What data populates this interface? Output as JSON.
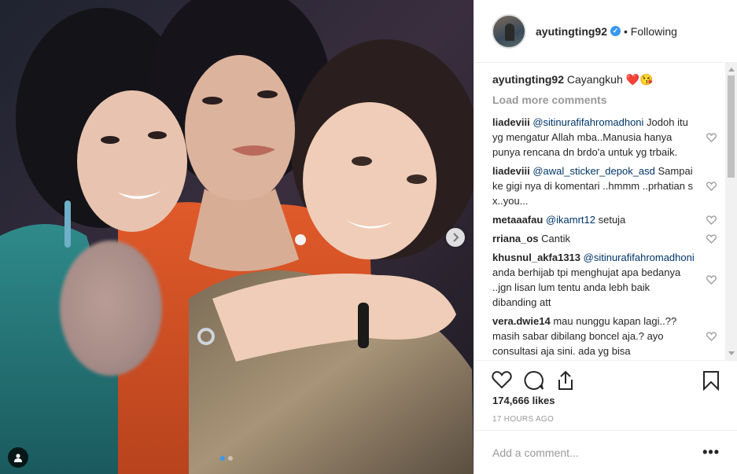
{
  "post": {
    "username": "ayutingting92",
    "follow_status": "• Following",
    "caption_user": "ayutingting92",
    "caption_text": "Cayangkuh ❤️😘",
    "load_more": "Load more comments",
    "likes": "174,666 likes",
    "time": "17 HOURS AGO",
    "add_comment_placeholder": "Add a comment...",
    "more_label": "•••"
  },
  "comments": [
    {
      "user": "liadeviii",
      "mention": "@sitinurafifahromadhoni",
      "text": " Jodoh itu yg mengatur Allah mba..Manusia hanya punya rencana dn brdo'a untuk yg trbaik."
    },
    {
      "user": "liadeviii",
      "mention": "@awal_sticker_depok_asd",
      "text": " Sampai ke gigi nya di komentari ..hmmm ..prhatian s x..you..."
    },
    {
      "user": "metaaafau",
      "mention": "@ikamrt12",
      "text": " setuja"
    },
    {
      "user": "rriana_os",
      "mention": "",
      "text": "Cantik"
    },
    {
      "user": "khusnul_akfa1313",
      "mention": "@sitinurafifahromadhoni",
      "text": " anda berhijab tpi menghujat apa bedanya ..jgn lisan lum tentu anda lebh baik dibanding att"
    },
    {
      "user": "vera.dwie14",
      "mention": "",
      "text": "mau nunggu kapan lagi..?? masih sabar dibilang boncel aja.? ayo consultasi aja sini. ada yg bisa"
    }
  ],
  "icons": {
    "like": "heart-icon",
    "comment": "comment-icon",
    "share": "share-icon",
    "save": "bookmark-icon",
    "next": "chevron-right-icon",
    "tag": "user-tag-icon",
    "verified": "verified-badge-icon"
  },
  "colors": {
    "link": "#003569",
    "accent": "#3897f0",
    "muted": "#999999"
  }
}
